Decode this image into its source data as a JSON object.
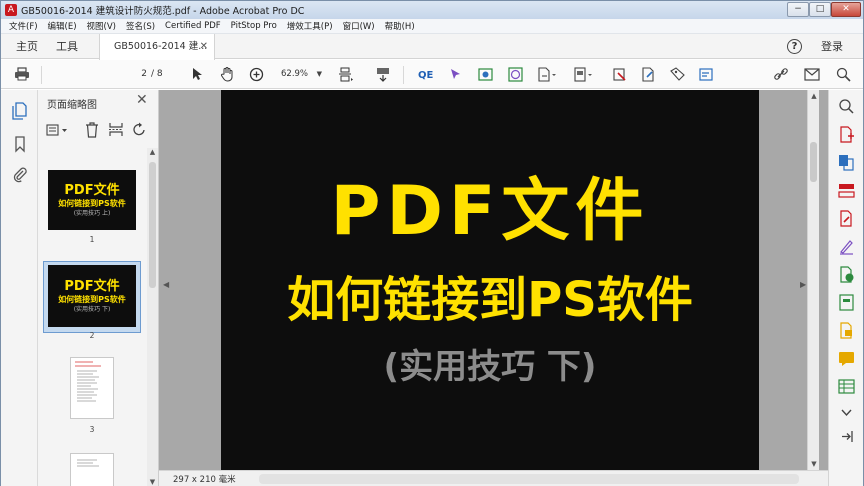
{
  "window": {
    "title": "GB50016-2014 建筑设计防火规范.pdf - Adobe Acrobat Pro DC",
    "app_icon_glyph": "A",
    "minimize_glyph": "−",
    "maximize_glyph": "□",
    "close_glyph": "✕"
  },
  "menu": {
    "items": [
      "文件(F)",
      "编辑(E)",
      "视图(V)",
      "签名(S)",
      "Certified PDF",
      "PitStop Pro",
      "增效工具(P)",
      "窗口(W)",
      "帮助(H)"
    ]
  },
  "tabs": {
    "home": "主页",
    "tools": "工具",
    "document": "GB50016-2014 建...",
    "close_glyph": "✕",
    "help_glyph": "?",
    "login": "登录"
  },
  "toolbar": {
    "page_current": "2",
    "page_total": "/ 8",
    "zoom": "62.9%",
    "zoom_caret": "▼",
    "icons": [
      "print-icon",
      "select-arrow-icon",
      "hand-icon",
      "zoom-in-icon",
      "fit-page-icon",
      "scroll-mode-icon",
      "quarkxpress-icon",
      "pen-tool-icon",
      "image-icon",
      "globe-icon",
      "export-icon",
      "document-icon",
      "stamp-icon",
      "edit-icon",
      "comment-icon",
      "form-icon",
      "link-icon",
      "mail-icon",
      "search-icon"
    ]
  },
  "thumbnails_panel": {
    "title": "页面缩略图",
    "close_glyph": "✕",
    "thumbs": [
      {
        "number": "1",
        "line1": "PDF文件",
        "line2": "如何链接到PS软件",
        "line3": "(实用技巧 上)"
      },
      {
        "number": "2",
        "line1": "PDF文件",
        "line2": "如何链接到PS软件",
        "line3": "(实用技巧 下)"
      },
      {
        "number": "3"
      }
    ],
    "scroll_up": "▲",
    "scroll_down": "▼"
  },
  "page": {
    "line1": "PDF文件",
    "line2": "如何链接到PS软件",
    "line3": "(实用技巧 下)",
    "text_color": "#ffe100",
    "subtext_color": "#8c8c8c",
    "background": "#0d0d0d"
  },
  "docarea": {
    "collapse_left": "◀",
    "collapse_right": "▶",
    "scroll_up": "▲",
    "scroll_down": "▼"
  },
  "status": {
    "page_size": "297 x 210 毫米"
  },
  "colors": {
    "accent_blue": "#2c6fbd",
    "acrobat_red": "#c8181f"
  }
}
